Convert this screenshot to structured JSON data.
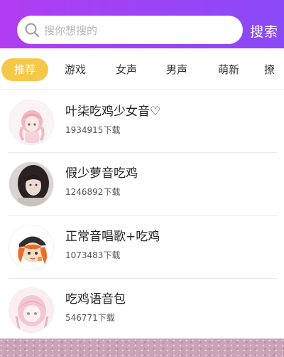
{
  "search": {
    "placeholder": "搜你想搜的",
    "button_label": "搜索"
  },
  "tabs": [
    {
      "label": "推荐",
      "active": true
    },
    {
      "label": "游戏"
    },
    {
      "label": "女声"
    },
    {
      "label": "男声"
    },
    {
      "label": "萌新"
    },
    {
      "label": "撩"
    }
  ],
  "items": [
    {
      "title": "叶柒吃鸡少女音♡",
      "downloads": "1934915下载",
      "avatar": "anime-pink-hair-girl"
    },
    {
      "title": "假少萝音吃鸡",
      "downloads": "1246892下载",
      "avatar": "photo-dark-hair-girl"
    },
    {
      "title": "正常音唱歌+吃鸡",
      "downloads": "1073483下载",
      "avatar": "cartoon-orange-hair-girl-cap"
    },
    {
      "title": "吃鸡语音包",
      "downloads": "546771下载",
      "avatar": "anime-light-pink-girl"
    }
  ],
  "colors": {
    "header_gradient": [
      "#b23cf2",
      "#8b4af7"
    ],
    "active_tab": "#f6c84a"
  }
}
